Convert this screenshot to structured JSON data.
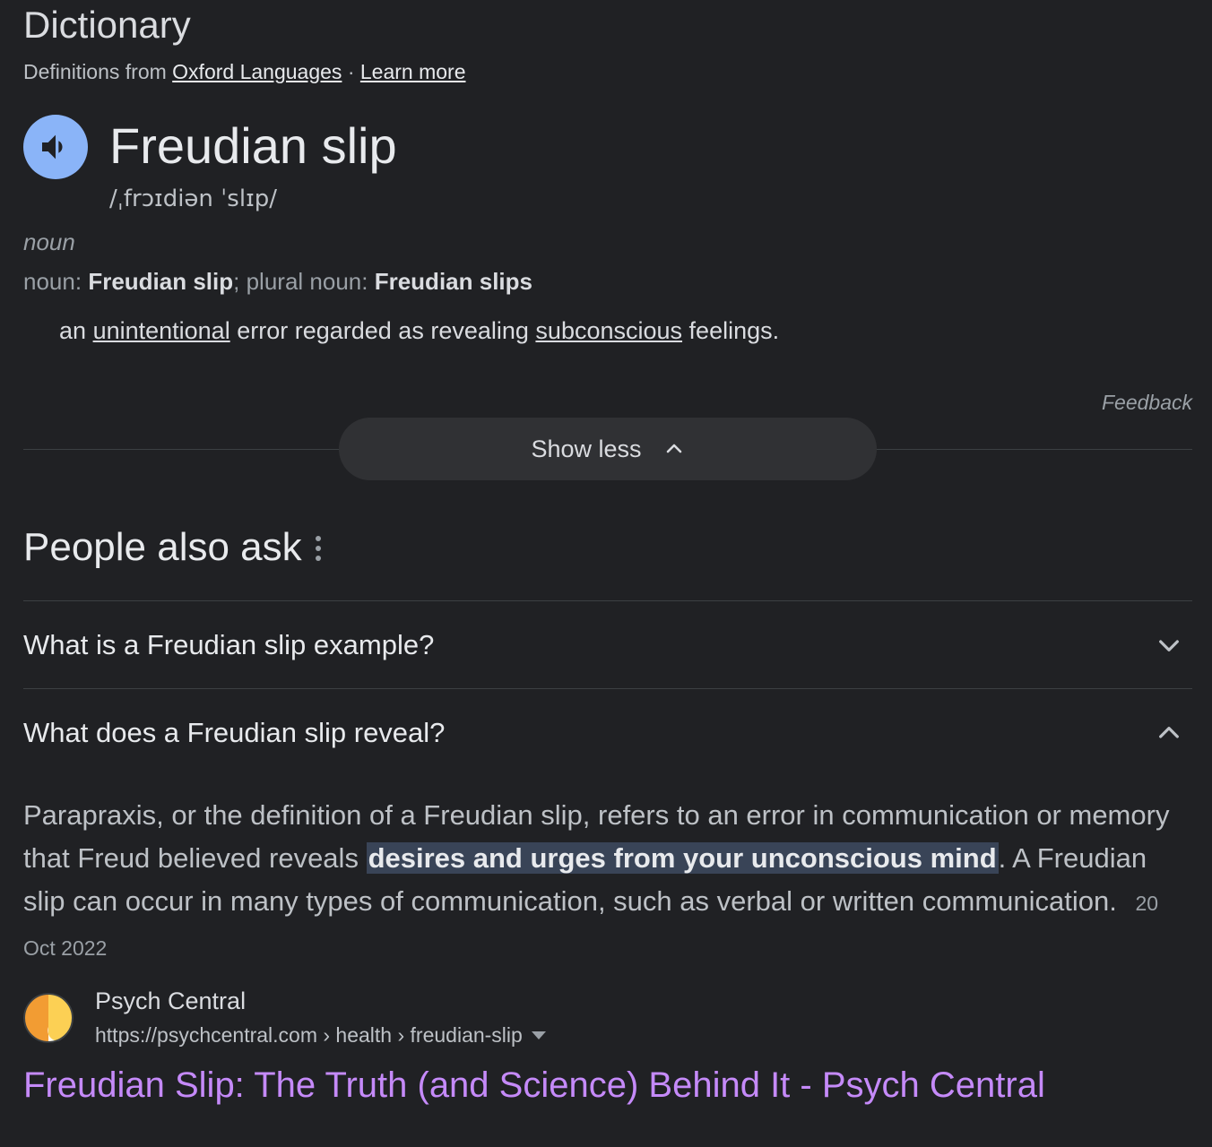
{
  "dictionary": {
    "heading": "Dictionary",
    "source_prefix": "Definitions from",
    "source_link": "Oxford Languages",
    "separator": "·",
    "learn_more": "Learn more",
    "speaker_icon": "volume-icon",
    "word": "Freudian slip",
    "phonetic": "/ˌfrɔɪdiən ˈslɪp/",
    "part_of_speech": "noun",
    "forms": {
      "label1": "noun:",
      "value1": "Freudian slip",
      "sep": ";",
      "label2": "plural noun:",
      "value2": "Freudian slips"
    },
    "definition": {
      "p1": "an",
      "link1": "unintentional",
      "p2": "error regarded as revealing",
      "link2": "subconscious",
      "p3": "feelings."
    },
    "feedback": "Feedback",
    "show_less": "Show less"
  },
  "paa": {
    "title": "People also ask",
    "questions": [
      {
        "text": "What is a Freudian slip example?",
        "state": "collapsed"
      },
      {
        "text": "What does a Freudian slip reveal?",
        "state": "expanded"
      }
    ],
    "answer": {
      "before": "Parapraxis, or the definition of a Freudian slip, refers to an error in communication or memory that Freud believed reveals",
      "highlight": "desires and urges from your unconscious mind",
      "after": ". A Freudian slip can occur in many types of communication, such as verbal or written communication.",
      "date": "20 Oct 2022"
    },
    "source": {
      "site_name": "Psych Central",
      "url": "https://psychcentral.com › health › freudian-slip",
      "result_title": "Freudian Slip: The Truth (and Science) Behind It - Psych Central",
      "favicon_colors": [
        "#f29c33",
        "#fcd054"
      ]
    }
  },
  "colors": {
    "background": "#202124",
    "speaker_bg": "#8ab4f8",
    "link_visited": "#c58af9",
    "highlight_bg": "#394457"
  }
}
